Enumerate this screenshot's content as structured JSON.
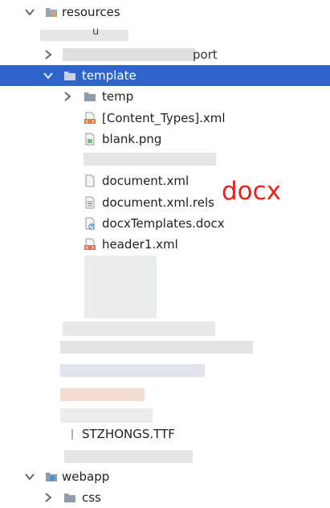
{
  "tree": {
    "resources_label": "resources",
    "partial_row_1_text": "u",
    "partial_row_2_text": "port",
    "template_label": "template",
    "temp_label": "temp",
    "content_types_label": "[Content_Types].xml",
    "blank_label": "blank.png",
    "document_xml_label": "document.xml",
    "document_rels_label": "document.xml.rels",
    "docx_templates_label": "docxTemplates.docx",
    "header1_label": "header1.xml",
    "font_file_label": "STZHONGS.TTF",
    "webapp_label": "webapp",
    "css_label": "css"
  },
  "annotation": {
    "text": "docx",
    "color": "#e8231d"
  },
  "colors": {
    "selection": "#2f65ca",
    "folder_icon": "#8f9baa",
    "xml_badge": "#e8744a"
  },
  "icons": {
    "folder": "folder-icon",
    "resources_folder": "resources-folder-icon",
    "xml_file": "xml-file-icon",
    "image_file": "image-file-icon",
    "text_file": "text-file-icon",
    "docx_file": "docx-file-icon",
    "font_file": "font-file-icon",
    "web_folder": "web-folder-icon",
    "expand_arrow": "chevron-down-icon",
    "collapse_arrow": "chevron-right-icon"
  }
}
